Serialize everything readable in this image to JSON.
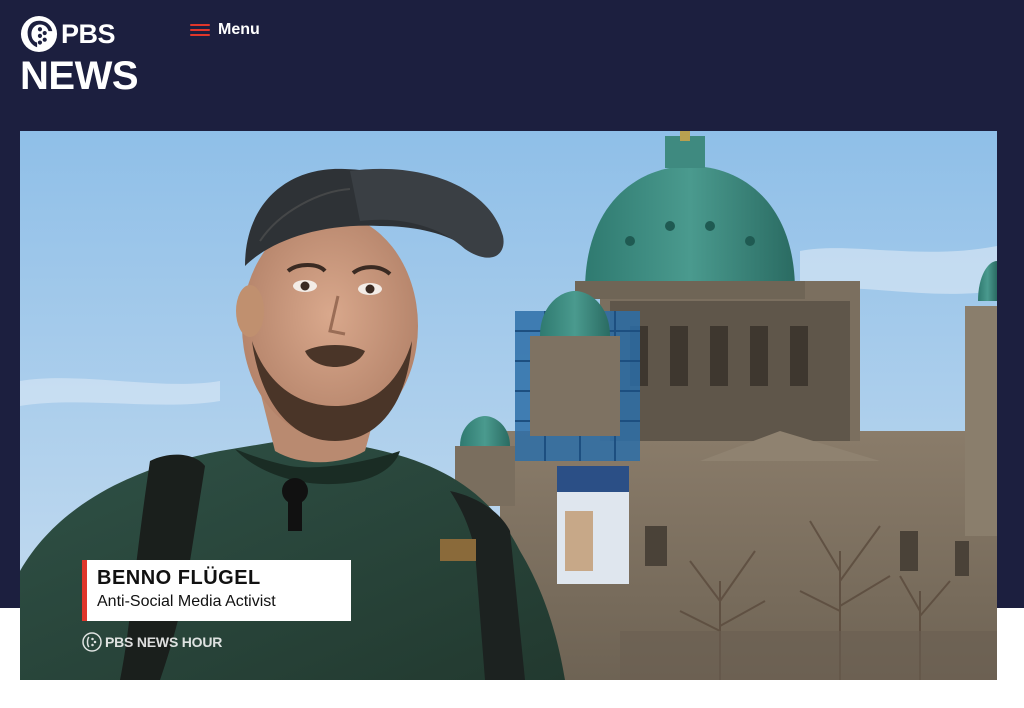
{
  "header": {
    "logo_brand": "PBS",
    "logo_section": "NEWS",
    "menu_label": "Menu",
    "menu_icon": "hamburger-icon",
    "background_color": "#1c1f3f",
    "accent_color": "#e0362b"
  },
  "video": {
    "lower_third": {
      "name": "BENNO FLÜGEL",
      "title": "Anti-Social Media Activist"
    },
    "watermark": "PBS NEWS HOUR"
  }
}
